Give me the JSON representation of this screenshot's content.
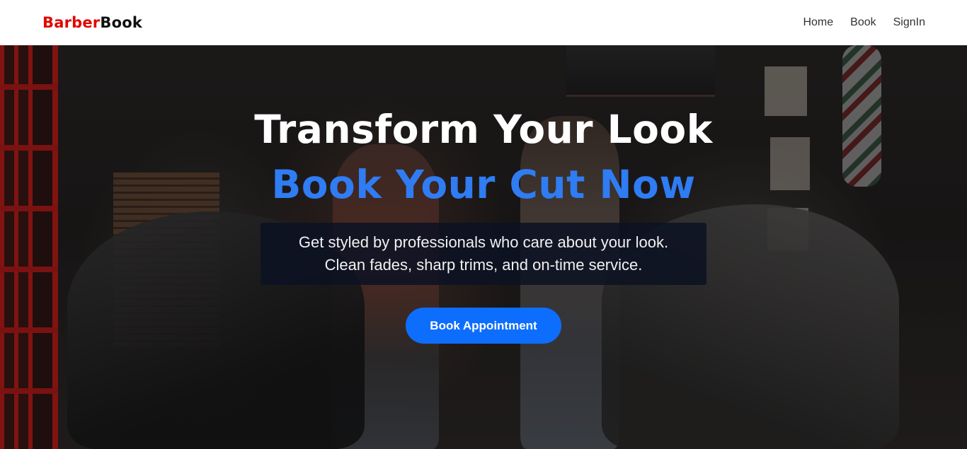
{
  "navbar": {
    "brand_part1": "Barber",
    "brand_part2": "Book",
    "links": [
      {
        "label": "Home"
      },
      {
        "label": "Book"
      },
      {
        "label": "SignIn"
      }
    ]
  },
  "hero": {
    "headline_line1": "Transform Your Look",
    "headline_line2": "Book Your Cut Now",
    "subtitle_line1": "Get styled by professionals who care about your look.",
    "subtitle_line2": "Clean fades, sharp trims, and on-time service.",
    "cta_label": "Book Appointment"
  },
  "colors": {
    "brand_red": "#e10600",
    "accent_blue": "#2f7cf3",
    "button_blue": "#0d6efd"
  }
}
